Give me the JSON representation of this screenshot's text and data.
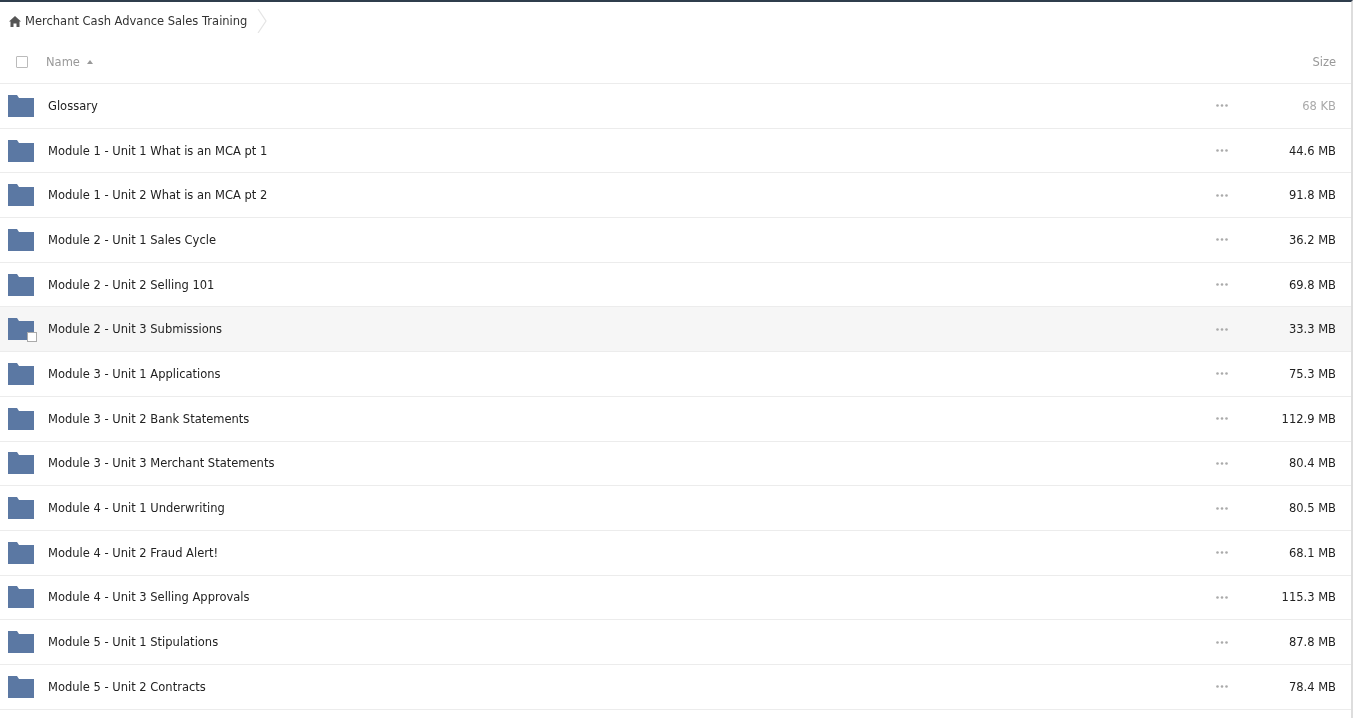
{
  "breadcrumb": {
    "label": "Merchant Cash Advance Sales Training"
  },
  "table": {
    "columns": [
      {
        "label": "Name",
        "sorted": true
      },
      {
        "label": "Size",
        "sorted": false
      }
    ],
    "select_all": {
      "checked": false
    },
    "rows": [
      {
        "name": "Glossary",
        "size": "68 KB",
        "size_faint": true,
        "hovered": false
      },
      {
        "name": "Module 1 - Unit 1 What is an MCA pt 1",
        "size": "44.6 MB",
        "size_faint": false,
        "hovered": false
      },
      {
        "name": "Module 1 - Unit 2 What is an MCA pt 2",
        "size": "91.8 MB",
        "size_faint": false,
        "hovered": false
      },
      {
        "name": "Module 2 - Unit 1 Sales Cycle",
        "size": "36.2 MB",
        "size_faint": false,
        "hovered": false
      },
      {
        "name": "Module 2 - Unit 2 Selling 101",
        "size": "69.8 MB",
        "size_faint": false,
        "hovered": false
      },
      {
        "name": "Module 2 - Unit 3 Submissions",
        "size": "33.3 MB",
        "size_faint": false,
        "hovered": true
      },
      {
        "name": "Module 3 - Unit 1 Applications",
        "size": "75.3 MB",
        "size_faint": false,
        "hovered": false
      },
      {
        "name": "Module 3 - Unit 2 Bank Statements",
        "size": "112.9 MB",
        "size_faint": false,
        "hovered": false
      },
      {
        "name": "Module 3 - Unit 3 Merchant Statements",
        "size": "80.4 MB",
        "size_faint": false,
        "hovered": false
      },
      {
        "name": "Module 4 - Unit 1 Underwriting",
        "size": "80.5 MB",
        "size_faint": false,
        "hovered": false
      },
      {
        "name": "Module 4 - Unit 2 Fraud Alert!",
        "size": "68.1 MB",
        "size_faint": false,
        "hovered": false
      },
      {
        "name": "Module 4 - Unit 3 Selling Approvals",
        "size": "115.3 MB",
        "size_faint": false,
        "hovered": false
      },
      {
        "name": "Module 5 - Unit 1 Stipulations",
        "size": "87.8 MB",
        "size_faint": false,
        "hovered": false
      },
      {
        "name": "Module 5 - Unit 2 Contracts",
        "size": "78.4 MB",
        "size_faint": false,
        "hovered": false
      }
    ]
  }
}
